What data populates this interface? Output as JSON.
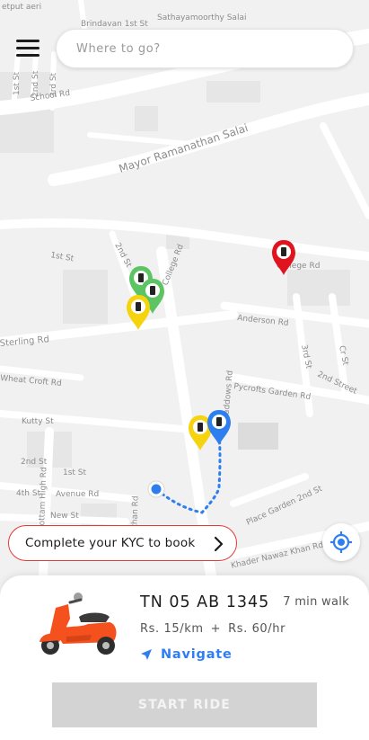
{
  "map": {
    "road_labels": {
      "etput_aeri": "etput aeri",
      "brindavan": "Brindavan 1st St",
      "sathyamoorthy": "Sathayamoorthy Salai",
      "first_st_top": "1st St",
      "second_st_top": "2nd St",
      "third_st_top": "3rd St",
      "school_rd": "School Rd",
      "mayor": "Mayor Ramanathan Salai",
      "first_st_mid": "1st St",
      "second_st_mid": "2nd St",
      "college_rd_left": "College Rd",
      "college_rd_right": "College Rd",
      "anderson": "Anderson Rd",
      "sterling": "Sterling Rd",
      "wheat_croft": "Wheat Croft Rd",
      "haddows": "Haddows Rd",
      "pycrofts": "Pycrofts Garden Rd",
      "third_st_right": "3rd St",
      "cr_st": "Cr St",
      "second_street": "2nd Street",
      "kutty": "Kutty St",
      "kottam": "Kottam High Rd",
      "second_st_low": "2nd St",
      "first_st_low": "1st St",
      "fourth_st": "4th St",
      "avenue": "Avenue Rd",
      "new_st": "New St",
      "nathan": "nathan Rd",
      "place_garden": "Place Garden 2nd St",
      "khader": "Khader Nawaz Khan Rd"
    }
  },
  "header": {
    "search_placeholder": "Where to go?"
  },
  "kyc": {
    "label": "Complete your KYC to book"
  },
  "vehicle": {
    "plate": "TN 05 AB 1345",
    "walk_time": "7 min walk",
    "rate_km": "Rs. 15/km",
    "rate_separator": "+",
    "rate_hr": "Rs. 60/hr",
    "navigate_label": "Navigate"
  },
  "actions": {
    "start_ride": "START RIDE"
  },
  "colors": {
    "accent_blue": "#2f7ef0",
    "kyc_border": "#e53935",
    "pin_green": "#5cc463",
    "pin_yellow": "#f5d40f",
    "pin_red": "#e0141e",
    "pin_blue": "#2f7ef0",
    "scooter_orange": "#f4511e",
    "disabled_button": "#d3d3d3"
  },
  "icons": {
    "menu": "hamburger-icon",
    "chevron": "chevron-right-icon",
    "locate": "crosshair-icon",
    "navigate": "navigation-arrow-icon",
    "scooter": "scooter-icon",
    "pin": "vehicle-pin-icon"
  }
}
